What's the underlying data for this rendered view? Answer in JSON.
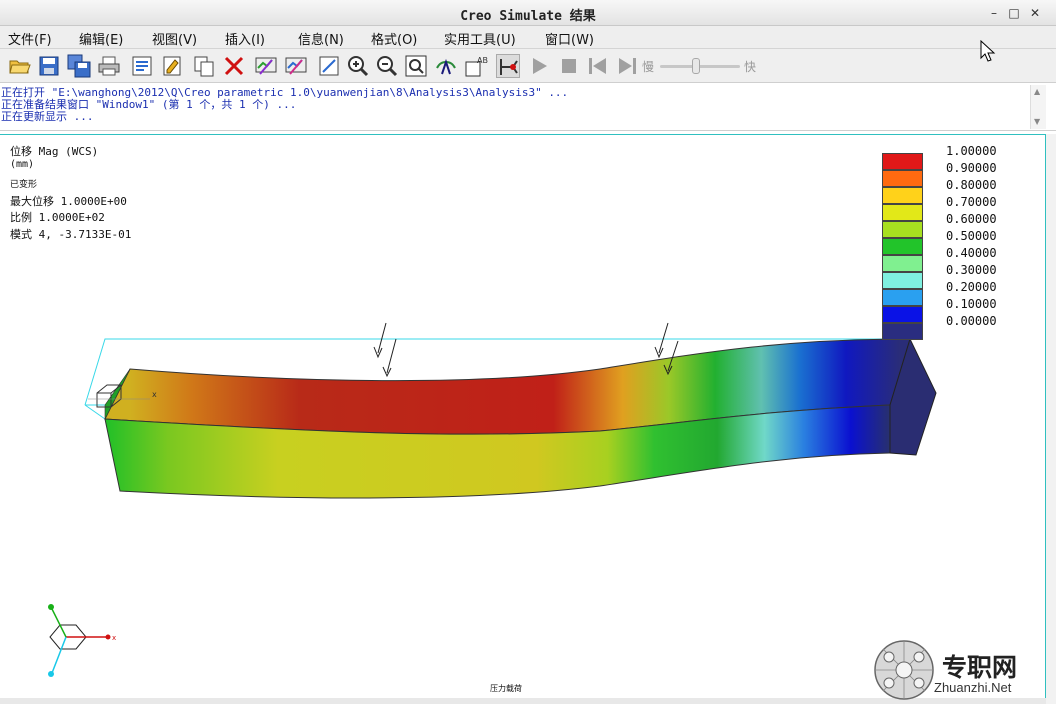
{
  "window": {
    "title": "Creo Simulate 结果",
    "controls": [
      "minimize-icon",
      "maximize-icon",
      "close-icon"
    ]
  },
  "menu": [
    {
      "label": "文件(F)"
    },
    {
      "label": "编辑(E)"
    },
    {
      "label": "视图(V)"
    },
    {
      "label": "插入(I)"
    },
    {
      "label": "信息(N)"
    },
    {
      "label": "格式(O)"
    },
    {
      "label": "实用工具(U)"
    },
    {
      "label": "窗口(W)"
    }
  ],
  "toolbar": {
    "icons": [
      "open-folder-icon",
      "save-icon",
      "save-all-icon",
      "print-icon",
      "export-icon",
      "edit-definition-icon",
      "copy-icon",
      "delete-icon",
      "show-icon",
      "hide-icon",
      "refit-icon",
      "zoom-in-icon",
      "zoom-out-icon",
      "zoom-window-icon",
      "spin-icon",
      "annotation-icon",
      "query-icon",
      "play-icon",
      "stop-icon",
      "step-back-icon",
      "step-forward-icon"
    ],
    "speed_slow": "慢",
    "speed_fast": "快",
    "speed_value": 0.45
  },
  "messages": [
    "正在打开 \"E:\\wanghong\\2012\\Q\\Creo parametric 1.0\\yuanwenjian\\8\\Analysis3\\Analysis3\" ...",
    "正在准备结果窗口 \"Window1\" (第 1 个，共 1 个) ...",
    "正在更新显示 ..."
  ],
  "result_info": {
    "quantity": "位移 Mag (WCS)",
    "unit": "(mm)",
    "deformed": "已变形",
    "max_disp": "最大位移   1.0000E+00",
    "scale": "比例  1.0000E+02",
    "mode": "模式  4, -3.7133E-01"
  },
  "legend": {
    "values": [
      "1.00000",
      "0.90000",
      "0.80000",
      "0.70000",
      "0.60000",
      "0.50000",
      "0.40000",
      "0.30000",
      "0.20000",
      "0.10000",
      "0.00000"
    ],
    "colors": [
      "#e01818",
      "#ff6a10",
      "#ffd21a",
      "#e2e818",
      "#a8e020",
      "#22c42a",
      "#80f090",
      "#7ff0e0",
      "#2aa0f0",
      "#0a12e6",
      "#2a2d80"
    ]
  },
  "axes": {
    "x": "x"
  },
  "bottom_caption": "压力载荷",
  "watermark": {
    "text": "专职网",
    "url": "Zhuanzhi.Net"
  }
}
